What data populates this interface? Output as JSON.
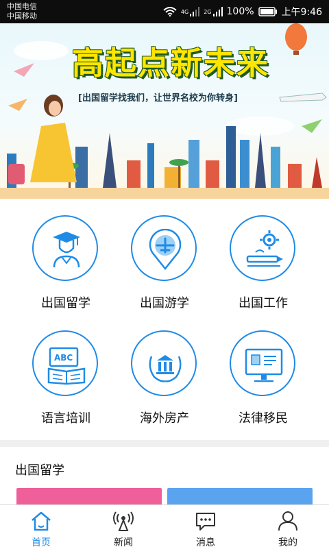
{
  "status_bar": {
    "carrier_1": "中国电信",
    "carrier_2": "中国移动",
    "network_1": "4G",
    "network_2": "2G",
    "battery": "100%",
    "time": "上午9:46"
  },
  "banner": {
    "title": "高起点新未来",
    "subtitle": "[出国留学找我们，让世界名校为你转身]"
  },
  "services": [
    {
      "label": "出国留学",
      "icon": "graduate-icon"
    },
    {
      "label": "出国游学",
      "icon": "airplane-pin-icon"
    },
    {
      "label": "出国工作",
      "icon": "gear-work-icon"
    },
    {
      "label": "语言培训",
      "icon": "abc-book-icon"
    },
    {
      "label": "海外房产",
      "icon": "building-laurel-icon"
    },
    {
      "label": "法律移民",
      "icon": "id-computer-icon"
    }
  ],
  "section": {
    "title": "出国留学"
  },
  "tabs": [
    {
      "label": "首页",
      "icon": "home-icon",
      "active": true
    },
    {
      "label": "新闻",
      "icon": "antenna-icon",
      "active": false
    },
    {
      "label": "消息",
      "icon": "chat-icon",
      "active": false
    },
    {
      "label": "我的",
      "icon": "person-icon",
      "active": false
    }
  ],
  "colors": {
    "accent": "#1f8be6",
    "pink_card": "#ef5f9a",
    "blue_card": "#5aa3ef"
  }
}
